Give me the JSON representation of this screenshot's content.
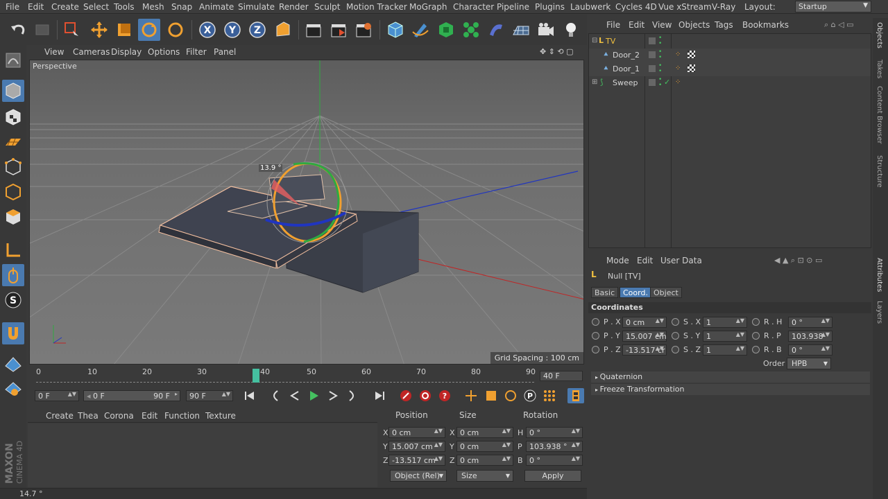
{
  "menubar": {
    "items": [
      "File",
      "Edit",
      "Create",
      "Select",
      "Tools",
      "Mesh",
      "Snap",
      "Animate",
      "Simulate",
      "Render",
      "Sculpt",
      "Motion Tracker",
      "MoGraph",
      "Character",
      "Pipeline",
      "Plugins",
      "Laubwerk",
      "Cycles 4D",
      "Vue xStream",
      "V-Ray"
    ],
    "layout_label": "Layout:",
    "layout_value": "Startup"
  },
  "viewport": {
    "menu": [
      "View",
      "Cameras",
      "Display",
      "Options",
      "Filter",
      "Panel"
    ],
    "label": "Perspective",
    "grid_spacing": "Grid Spacing : 100 cm",
    "angle_readout": "13.9 °"
  },
  "timeline": {
    "ticks": [
      "0",
      "10",
      "20",
      "30",
      "40",
      "50",
      "60",
      "70",
      "80",
      "90"
    ],
    "current_frame": "40 F",
    "start_field": "0 F",
    "range_start": "0 F",
    "range_end": "90 F",
    "end_field": "90 F"
  },
  "material_menu": [
    "Create",
    "Thea",
    "Corona",
    "Edit",
    "Function",
    "Texture"
  ],
  "coord_manager": {
    "headers": [
      "Position",
      "Size",
      "Rotation"
    ],
    "rows": [
      {
        "a": "X",
        "pos": "0 cm",
        "b": "X",
        "size": "0 cm",
        "c": "H",
        "rot": "0 °"
      },
      {
        "a": "Y",
        "pos": "15.007 cm",
        "b": "Y",
        "size": "0 cm",
        "c": "P",
        "rot": "103.938 °"
      },
      {
        "a": "Z",
        "pos": "-13.517 cm",
        "b": "Z",
        "size": "0 cm",
        "c": "B",
        "rot": "0 °"
      }
    ],
    "mode_select": "Object (Rel)",
    "size_select": "Size",
    "apply_label": "Apply"
  },
  "status": "14.7 °",
  "logo": {
    "line1": "MAXON",
    "line2": "CINEMA 4D"
  },
  "object_manager": {
    "menu": [
      "File",
      "Edit",
      "View",
      "Objects",
      "Tags",
      "Bookmarks"
    ],
    "objects": [
      {
        "name": "TV",
        "indent": 0,
        "color": "#f0c040"
      },
      {
        "name": "Door_2",
        "indent": 1,
        "color": "#d7d7d7"
      },
      {
        "name": "Door_1",
        "indent": 1,
        "color": "#d7d7d7"
      },
      {
        "name": "Sweep",
        "indent": 0,
        "color": "#d7d7d7"
      }
    ]
  },
  "attributes": {
    "menu": [
      "Mode",
      "Edit",
      "User Data"
    ],
    "title": "Null [TV]",
    "tabs": [
      "Basic",
      "Coord.",
      "Object"
    ],
    "active_tab": "Coord.",
    "section": "Coordinates",
    "fields": [
      {
        "label": "P . X",
        "value": "0 cm"
      },
      {
        "label": "P . Y",
        "value": "15.007 cm"
      },
      {
        "label": "P . Z",
        "value": "-13.517 cr"
      },
      {
        "label": "S . X",
        "value": "1"
      },
      {
        "label": "S . Y",
        "value": "1"
      },
      {
        "label": "S . Z",
        "value": "1"
      },
      {
        "label": "R . H",
        "value": "0 °"
      },
      {
        "label": "R . P",
        "value": "103.938 °"
      },
      {
        "label": "R . B",
        "value": "0 °"
      }
    ],
    "order_label": "Order",
    "order_value": "HPB",
    "sections": [
      "Quaternion",
      "Freeze Transformation"
    ]
  },
  "right_tabs": [
    "Objects",
    "Takes",
    "Content Browser",
    "Structure",
    "Attributes",
    "Layers"
  ],
  "colors": {
    "accent": "#4a7ab0",
    "orange": "#f0a030",
    "green": "#45c060",
    "viewport_bg": "#6e6e6e"
  }
}
